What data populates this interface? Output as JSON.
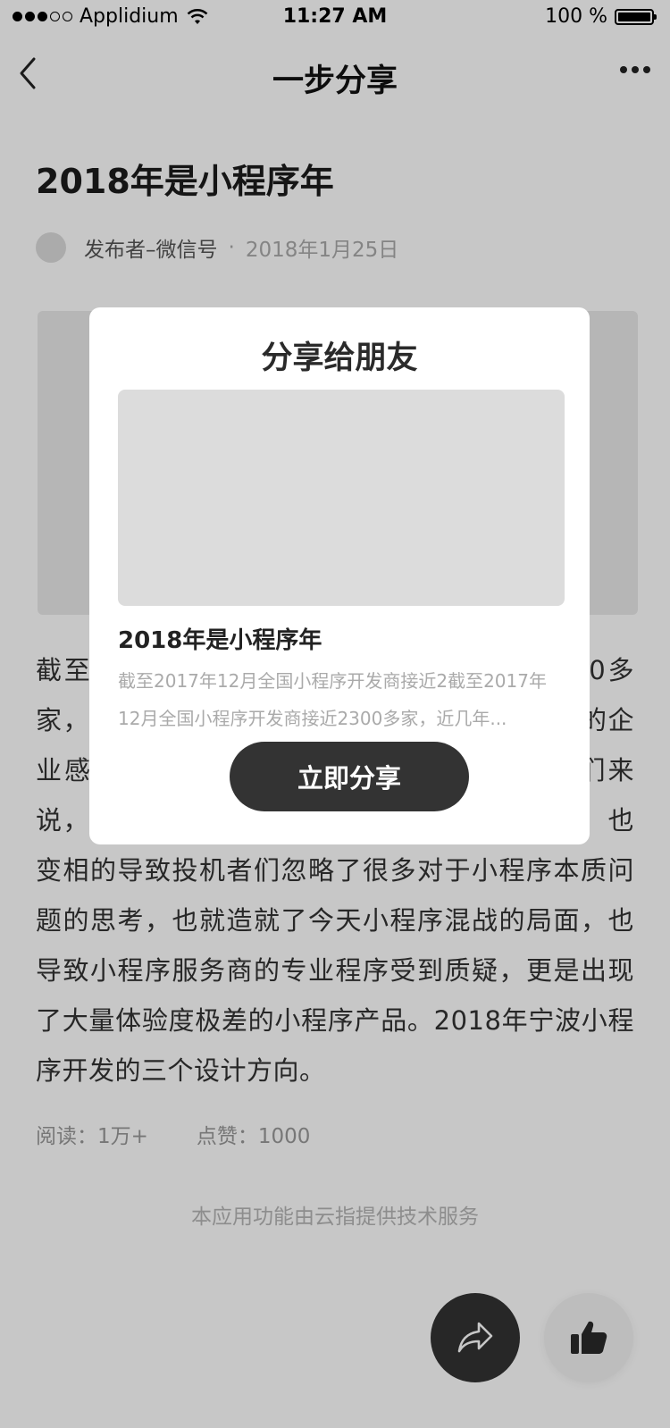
{
  "status_bar": {
    "carrier": "Applidium",
    "time": "11:27 AM",
    "battery": "100 %"
  },
  "nav": {
    "title": "一步分享",
    "back_icon": "chevron-left-icon",
    "more_icon": "more-dots-icon"
  },
  "article": {
    "title": "2018年是小程序年",
    "publisher": "发布者–微信号",
    "separator": "·",
    "date": "2018年1月25日",
    "body": "截至2017年12月全国小程序开发商接近2300多家，近几年小程序的发展速度之快，越来越多的企业感受到的小程序的魅力。对于许多投机者们来说，谁能拿到一手的小程序资源才是当务之急，也变相的导致投机者们忽略了很多对于小程序本质问题的思考，也就造就了今天小程序混战的局面，也导致小程序服务商的专业程序受到质疑，更是出现了大量体验度极差的小程序产品。2018年宁波小程序开发的三个设计方向。",
    "reads": "阅读：1万+",
    "likes": "点赞：1000"
  },
  "footer_note": "本应用功能由云指提供技术服务",
  "fab": {
    "share_icon": "share-arrow-icon",
    "like_icon": "thumbs-up-icon"
  },
  "modal": {
    "title": "分享给朋友",
    "card_title": "2018年是小程序年",
    "card_desc": "截至2017年12月全国小程序开发商接近2截至2017年12月全国小程序开发商接近2300多家，近几年...",
    "share_button": "立即分享"
  },
  "colors": {
    "dark": "#333333",
    "overlay": "rgba(0,0,0,0.22)",
    "muted_text": "#aaaaaa"
  }
}
